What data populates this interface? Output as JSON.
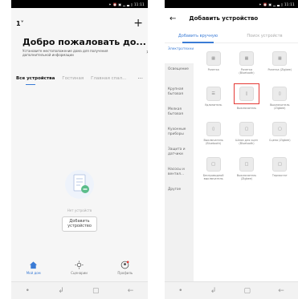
{
  "status": {
    "text": "✶ ⏰ ▣ ▁ ▃ ▯ 11:11"
  },
  "screen1": {
    "home_selector": "1˅",
    "plus_label": "+",
    "welcome_title": "Добро пожаловать до...",
    "welcome_sub": "Установите местоположение дома для получения дополнительной информации",
    "welcome_arrow": "›",
    "tabs": [
      "Все устройства",
      "Гостиная",
      "Главная спал..."
    ],
    "tabs_more": "···",
    "empty_text": "Нет устройств",
    "add_button": "Добавить устройство",
    "bottom_tabs": [
      "Мой дом",
      "Сценарии",
      "Профиль"
    ]
  },
  "screen2": {
    "back": "←",
    "title": "Добавить устройство",
    "tabs": [
      "Добавить вручную",
      "Поиск устройств"
    ],
    "categories": [
      "Электротехника",
      "Освещение",
      "Крупная бытовая",
      "Мелкая бытовая",
      "Кухонные приборы",
      "Защита и датчики",
      "Насосы и вентил...",
      "Другое"
    ],
    "devices": [
      {
        "label": "Розетка",
        "glyph": "▦"
      },
      {
        "label": "Розетка (Bluetooth)",
        "glyph": "▦"
      },
      {
        "label": "Розетка (Zigbee)",
        "glyph": "▦"
      },
      {
        "label": "Удлинитель",
        "glyph": "☰"
      },
      {
        "label": "Выключатель",
        "glyph": "▯",
        "highlight": true
      },
      {
        "label": "Выключатель (Zigbee)",
        "glyph": "▯"
      },
      {
        "label": "Выключатель (Bluetooth)",
        "glyph": "▯"
      },
      {
        "label": "Шлюз для сцен (Bluetooth)",
        "glyph": "▢"
      },
      {
        "label": "Сцена (Zigbee)",
        "glyph": "▢"
      },
      {
        "label": "Беспроводной выключатель",
        "glyph": "□"
      },
      {
        "label": "Выключатель (Zigbee)",
        "glyph": "□"
      },
      {
        "label": "Термостат",
        "glyph": "□"
      }
    ]
  },
  "navbar": [
    "•",
    "↲",
    "▢",
    "←"
  ],
  "colors": {
    "accent": "#3a7bd5",
    "highlight": "#e53935"
  }
}
